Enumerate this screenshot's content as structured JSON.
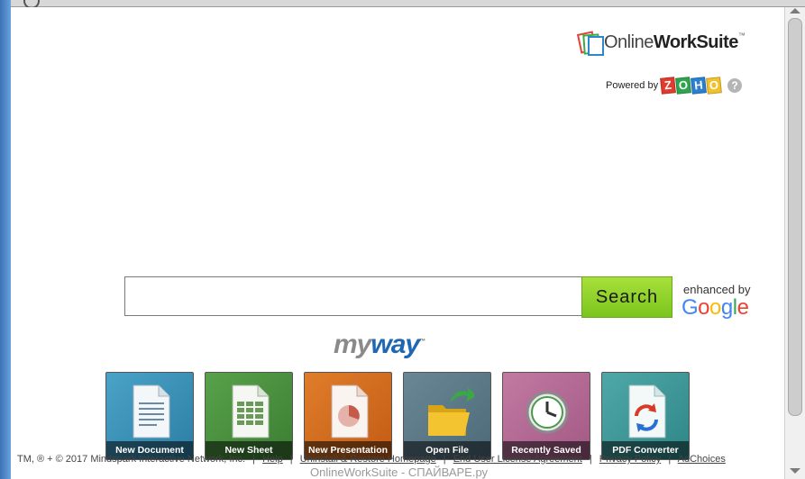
{
  "brand": {
    "name_plain": "Online",
    "name_bold": "WorkSuite",
    "tm": "™",
    "powered_by": "Powered by",
    "zoho_letters": [
      "Z",
      "O",
      "H",
      "O"
    ],
    "zoho_colors": [
      "#e03b2f",
      "#2ea44f",
      "#2a7fd2",
      "#f2c12e"
    ],
    "help_glyph": "?"
  },
  "search": {
    "value": "",
    "button_label": "Search",
    "enhanced_by": "enhanced by",
    "google_letters": [
      "G",
      "o",
      "o",
      "g",
      "l",
      "e"
    ],
    "google_colors": [
      "#4285f4",
      "#ea4335",
      "#fbbc05",
      "#4285f4",
      "#34a853",
      "#ea4335"
    ]
  },
  "myway": {
    "part1": "my",
    "part2": "way",
    "tm": "™"
  },
  "tiles": [
    {
      "label": "New Document",
      "icon": "document-icon"
    },
    {
      "label": "New Sheet",
      "icon": "spreadsheet-icon"
    },
    {
      "label": "New Presentation",
      "icon": "presentation-icon"
    },
    {
      "label": "Open File",
      "icon": "folder-icon"
    },
    {
      "label": "Recently Saved",
      "icon": "clock-icon"
    },
    {
      "label": "PDF Converter",
      "icon": "pdf-convert-icon"
    }
  ],
  "footer": {
    "copyright": "TM, ® + © 2017 Mindspark Interactive Network, Inc.",
    "links": [
      "Help",
      "Uninstall & Restore Homepage",
      "End User License Agreement",
      "Privacy Policy",
      "AdChoices"
    ],
    "separator": "|"
  },
  "watermark": "OnlineWorkSuite - СПАЙВАРЕ.ру",
  "colors": {
    "search_button": "#8fd22a",
    "myway_blue": "#1f66b3",
    "myway_gray": "#8a8a8a"
  }
}
